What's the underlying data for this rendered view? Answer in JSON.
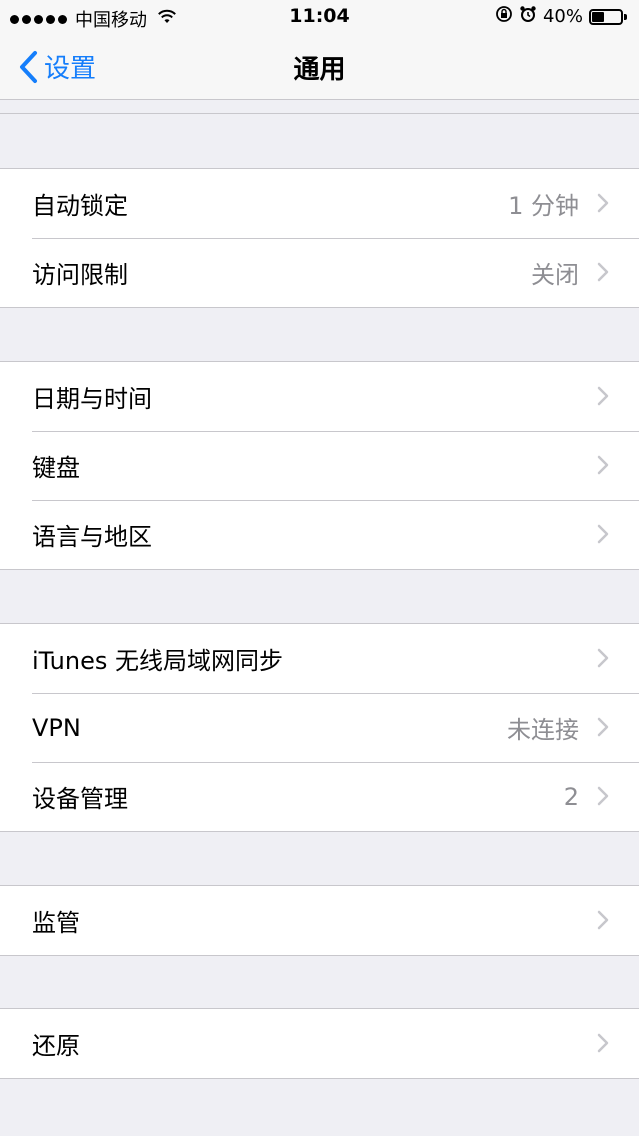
{
  "status_bar": {
    "carrier": "中国移动",
    "time": "11:04",
    "battery": "40%"
  },
  "nav": {
    "back_label": "设置",
    "title": "通用"
  },
  "groups": [
    {
      "rows": [
        {
          "label": "自动锁定",
          "value": "1 分钟"
        },
        {
          "label": "访问限制",
          "value": "关闭"
        }
      ]
    },
    {
      "rows": [
        {
          "label": "日期与时间",
          "value": ""
        },
        {
          "label": "键盘",
          "value": ""
        },
        {
          "label": "语言与地区",
          "value": ""
        }
      ]
    },
    {
      "rows": [
        {
          "label": "iTunes 无线局域网同步",
          "value": ""
        },
        {
          "label": "VPN",
          "value": "未连接"
        },
        {
          "label": "设备管理",
          "value": "2"
        }
      ]
    },
    {
      "rows": [
        {
          "label": "监管",
          "value": ""
        }
      ]
    },
    {
      "rows": [
        {
          "label": "还原",
          "value": ""
        }
      ]
    }
  ],
  "colors": {
    "accent": "#157efb",
    "background": "#efeff4",
    "secondary_text": "#8e8e93",
    "separator": "#c8c7cc"
  },
  "icons": {
    "signal": "signal-dots-icon",
    "wifi": "wifi-icon",
    "orientation_lock": "orientation-lock-icon",
    "alarm": "alarm-icon",
    "battery": "battery-icon",
    "back": "chevron-left-icon",
    "disclosure": "chevron-right-icon"
  }
}
